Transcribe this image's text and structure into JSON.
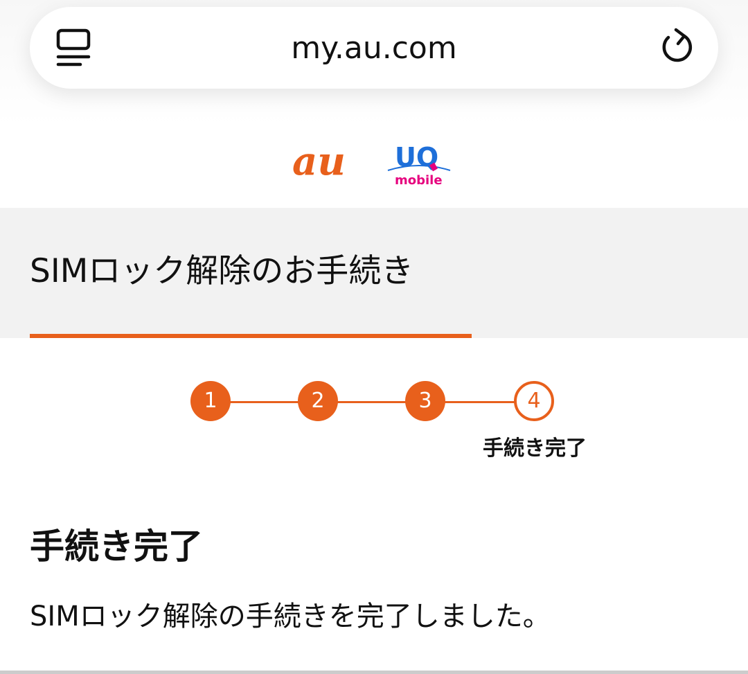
{
  "browser": {
    "url": "my.au.com",
    "tab_icon": "tabs-icon",
    "reload_icon": "reload-icon"
  },
  "logos": {
    "au": "au",
    "uq_top": "UQ",
    "uq_bottom": "mobile"
  },
  "header": {
    "title": "SIMロック解除のお手続き"
  },
  "stepper": {
    "steps": [
      "1",
      "2",
      "3",
      "4"
    ],
    "current_step": 4,
    "current_label": "手続き完了"
  },
  "content": {
    "heading": "手続き完了",
    "message": "SIMロック解除の手続きを完了しました。"
  },
  "colors": {
    "accent": "#e8601c",
    "uq_blue": "#1e6fd9",
    "uq_pink": "#e6007e",
    "title_band_bg": "#f2f2f2"
  }
}
